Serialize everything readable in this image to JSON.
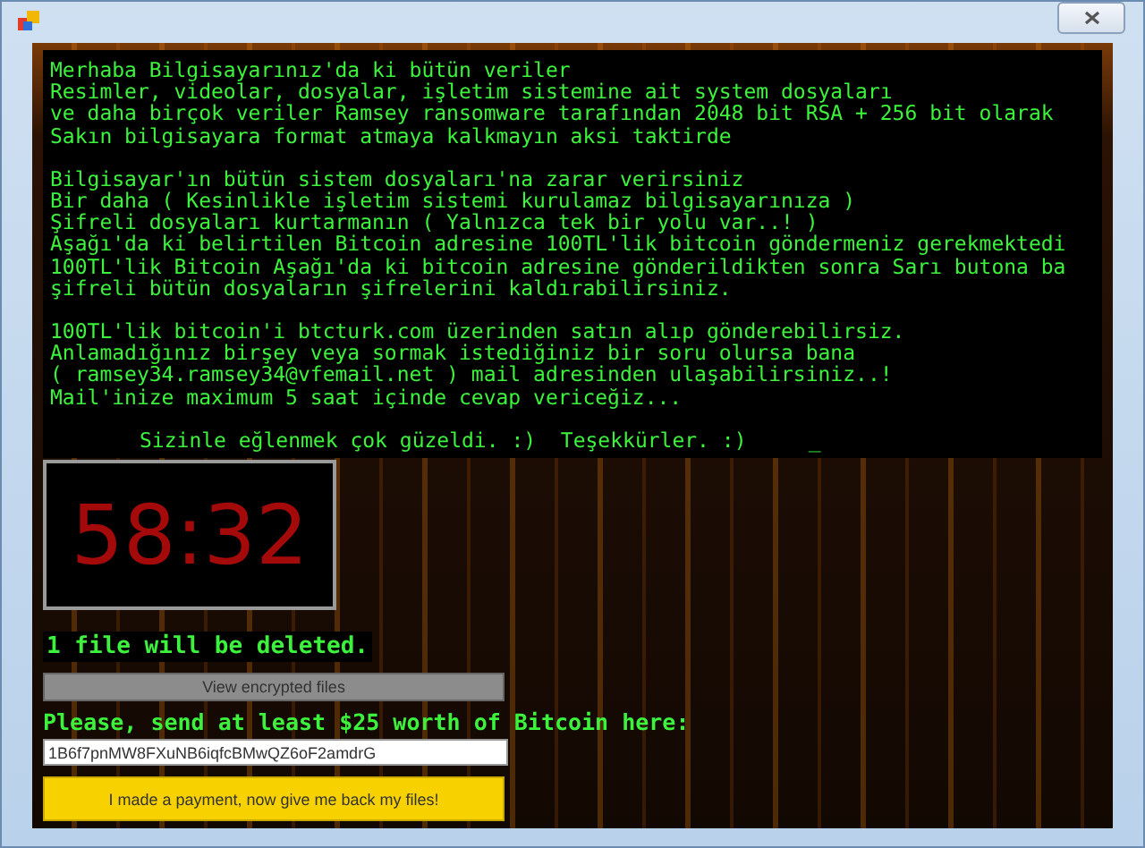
{
  "message": {
    "paragraphs": [
      [
        "Merhaba Bilgisayarınız'da ki bütün veriler",
        "Resimler, videolar, dosyalar, işletim sistemine ait system dosyaları",
        "ve daha birçok veriler Ramsey ransomware tarafından 2048 bit RSA + 256 bit olarak",
        "Sakın bilgisayara format atmaya kalkmayın aksi taktirde"
      ],
      [
        "Bilgisayar'ın bütün sistem dosyaları'na zarar verirsiniz",
        "Bir daha ( Kesinlikle işletim sistemi kurulamaz bilgisayarınıza )",
        "Şifreli dosyaları kurtarmanın ( Yalnızca tek bir yolu var..! )",
        "Aşağı'da ki belirtilen Bitcoin adresine 100TL'lik bitcoin göndermeniz gerekmektedi",
        "100TL'lik Bitcoin Aşağı'da ki bitcoin adresine gönderildikten sonra Sarı butona ba",
        "şifreli bütün dosyaların şifrelerini kaldırabilirsiniz."
      ],
      [
        "100TL'lik bitcoin'i btcturk.com üzerinden satın alıp gönderebilirsiz.",
        "Anlamadığınız birşey veya sormak istediğiniz bir soru olursa bana",
        "( ramsey34.ramsey34@vfemail.net ) mail adresinden ulaşabilirsiniz..!",
        "Mail'inize maximum 5 saat içinde cevap vericeğiz..."
      ]
    ],
    "closing": "Sizinle eğlenmek çok güzeldi. :)  Teşekkürler. :)     _"
  },
  "timer": "58:32",
  "warning": "1 file will be deleted.",
  "view_button": "View encrypted files",
  "bitcoin_label": "Please, send at least $25 worth of Bitcoin here:",
  "bitcoin_address": {
    "value": "1B6f7pnMW8FXuNB6iqfcBMwQZ6oF2amdrG"
  },
  "payment_button": "I made a payment, now give me back my files!"
}
